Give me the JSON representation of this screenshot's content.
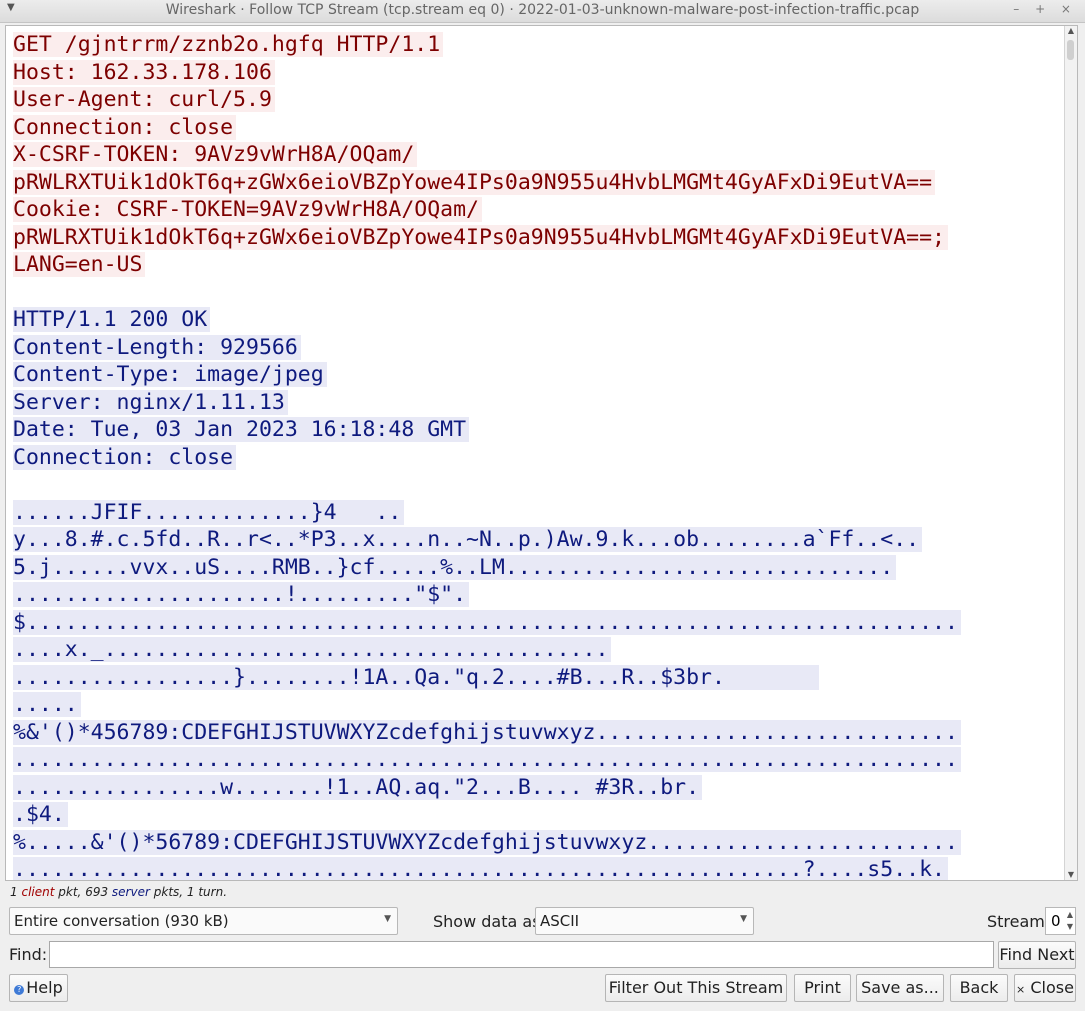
{
  "window": {
    "title": "Wireshark · Follow TCP Stream (tcp.stream eq 0) · 2022-01-03-unknown-malware-post-infection-traffic.pcap",
    "menu_icon": "window-menu-icon",
    "controls": "–  +  ×"
  },
  "stream": {
    "lines": [
      {
        "who": "client",
        "text": "GET /gjntrrm/zznb2o.hgfq HTTP/1.1"
      },
      {
        "who": "client",
        "text": "Host: 162.33.178.106"
      },
      {
        "who": "client",
        "text": "User-Agent: curl/5.9"
      },
      {
        "who": "client",
        "text": "Connection: close"
      },
      {
        "who": "client",
        "text": "X-CSRF-TOKEN: 9AVz9vWrH8A/OQam/"
      },
      {
        "who": "client",
        "text": "pRWLRXTUik1dOkT6q+zGWx6eioVBZpYowe4IPs0a9N955u4HvbLMGMt4GyAFxDi9EutVA=="
      },
      {
        "who": "client",
        "text": "Cookie: CSRF-TOKEN=9AVz9vWrH8A/OQam/"
      },
      {
        "who": "client",
        "text": "pRWLRXTUik1dOkT6q+zGWx6eioVBZpYowe4IPs0a9N955u4HvbLMGMt4GyAFxDi9EutVA==;"
      },
      {
        "who": "client",
        "text": "LANG=en-US"
      },
      {
        "who": "blank",
        "text": ""
      },
      {
        "who": "server",
        "text": "HTTP/1.1 200 OK"
      },
      {
        "who": "server",
        "text": "Content-Length: 929566"
      },
      {
        "who": "server",
        "text": "Content-Type: image/jpeg"
      },
      {
        "who": "server",
        "text": "Server: nginx/1.11.13"
      },
      {
        "who": "server",
        "text": "Date: Tue, 03 Jan 2023 16:18:48 GMT"
      },
      {
        "who": "server",
        "text": "Connection: close"
      },
      {
        "who": "blank",
        "text": ""
      },
      {
        "who": "server",
        "text": "......JFIF.............}4   .."
      },
      {
        "who": "server",
        "text": "y...8.#.c.5fd..R..r<..*P3..x....n..~N..p.)Aw.9.k...ob........a`Ff..<.."
      },
      {
        "who": "server",
        "text": "5.j......vvx..uS....RMB..}cf.....%..LM.............................."
      },
      {
        "who": "server",
        "text": ".....................!.........\"$\"."
      },
      {
        "who": "server",
        "text": "$........................................................................"
      },
      {
        "who": "server",
        "text": "....x._......................................."
      },
      {
        "who": "server",
        "text": ".................}........!1A..Qa.\"q.2....#B...R..$3br.       "
      },
      {
        "who": "server",
        "text": "....."
      },
      {
        "who": "server",
        "text": "%&'()*456789:CDEFGHIJSTUVWXYZcdefghijstuvwxyz............................"
      },
      {
        "who": "server",
        "text": "........................................................................."
      },
      {
        "who": "server",
        "text": "................w.......!1..AQ.aq.\"2...B.... #3R..br."
      },
      {
        "who": "server",
        "text": ".$4."
      },
      {
        "who": "server",
        "text": "%.....&'()*56789:CDEFGHIJSTUVWXYZcdefghijstuvwxyz........................"
      },
      {
        "who": "server",
        "text": ".............................................................?....s5..k."
      }
    ]
  },
  "stats": {
    "count_client": "1",
    "client_word": "client",
    "mid": "pkt,",
    "count_server": "693",
    "server_word": "server",
    "tail": "pkts, 1 turn."
  },
  "controls": {
    "conversation_select": "Entire conversation (930 kB)",
    "show_data_label": "Show data as",
    "show_data_value": "ASCII",
    "stream_label": "Stream",
    "stream_value": "0",
    "find_label": "Find:",
    "find_value": "",
    "find_next_label": "Find Next"
  },
  "buttons": {
    "help": "Help",
    "filter_out": "Filter Out This Stream",
    "print": "Print",
    "save_as": "Save as...",
    "back": "Back",
    "close": "Close"
  }
}
